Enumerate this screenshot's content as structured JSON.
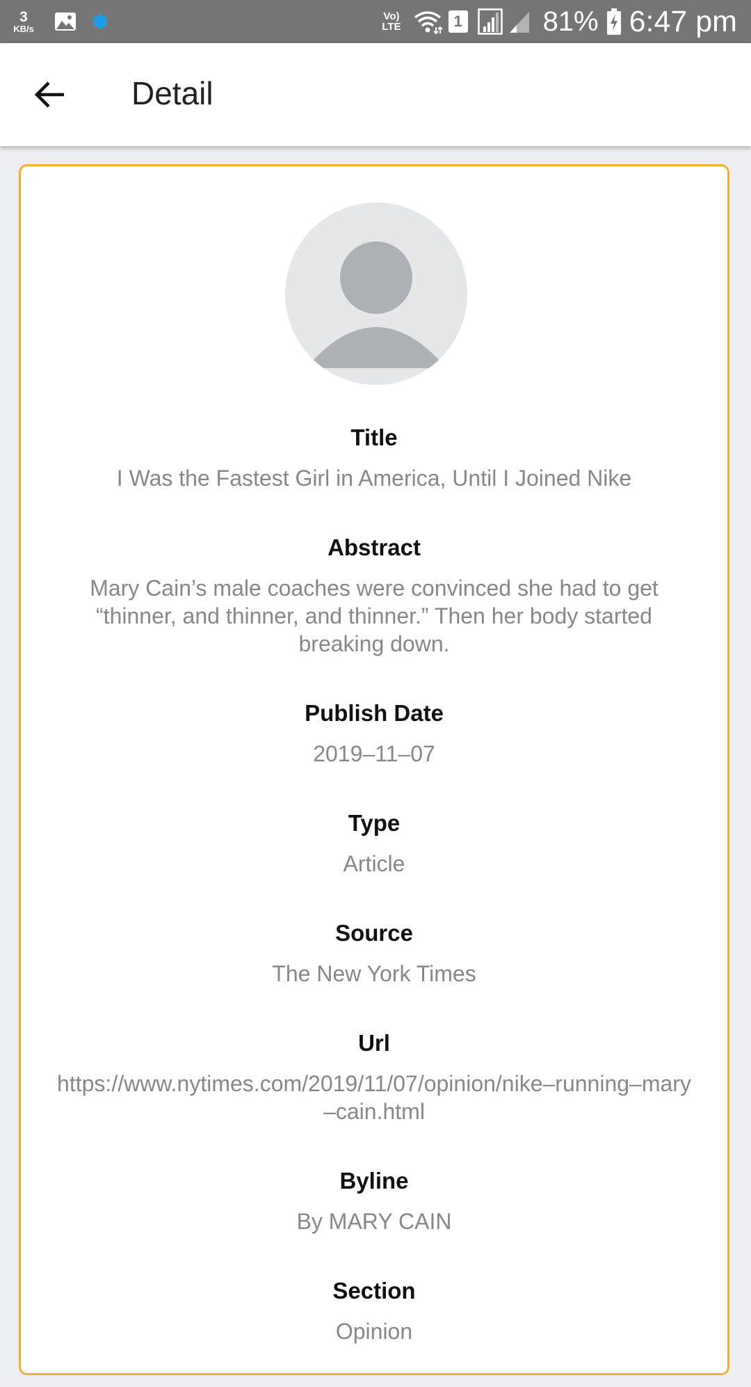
{
  "status_bar": {
    "net_speed_value": "3",
    "net_speed_unit": "KB/s",
    "volte_top": "Vo)",
    "volte_bottom": "LTE",
    "sim_slot": "1",
    "battery_percent": "81%",
    "time": "6:47 pm",
    "icons": [
      "gallery-icon",
      "app-notification-icon",
      "wifi-icon",
      "signal-icon",
      "battery-charging-icon"
    ],
    "notification_dot_color": "#1e9be9"
  },
  "app_bar": {
    "title": "Detail",
    "back_icon": "arrow-left-icon"
  },
  "card": {
    "border_color": "#f2ae2e",
    "avatar_icon": "person-placeholder-icon",
    "fields": [
      {
        "label": "Title",
        "value": "I Was the Fastest Girl in America, Until I Joined Nike"
      },
      {
        "label": "Abstract",
        "value": "Mary Cain’s male coaches were convinced she had to get “thinner, and thinner, and thinner.” Then her body started breaking down."
      },
      {
        "label": "Publish Date",
        "value": "2019–11–07"
      },
      {
        "label": "Type",
        "value": "Article"
      },
      {
        "label": "Source",
        "value": "The New York Times"
      },
      {
        "label": "Url",
        "value": "https://www.nytimes.com/2019/11/07/opinion/nike–running–mary–cain.html"
      },
      {
        "label": "Byline",
        "value": "By MARY CAIN"
      },
      {
        "label": "Section",
        "value": "Opinion"
      }
    ]
  }
}
